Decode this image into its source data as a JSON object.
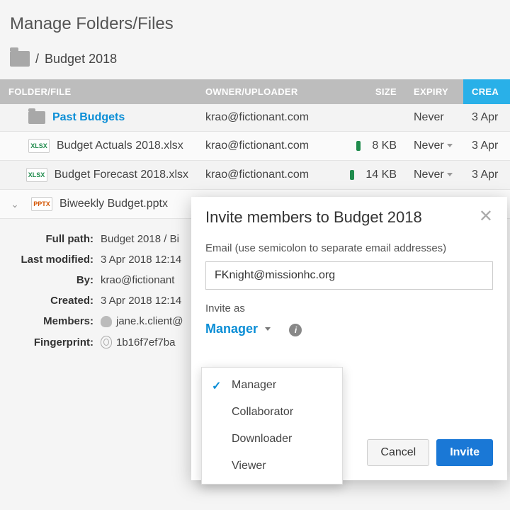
{
  "page": {
    "title": "Manage Folders/Files"
  },
  "breadcrumb": {
    "sep": "/",
    "folder": "Budget 2018"
  },
  "table": {
    "headers": {
      "file": "FOLDER/FILE",
      "owner": "OWNER/UPLOADER",
      "size": "SIZE",
      "expiry": "EXPIRY",
      "created": "CREA"
    },
    "rows": [
      {
        "icon": "folder",
        "name": "Past Budgets",
        "link": true,
        "owner": "krao@fictionant.com",
        "size": "",
        "expiry": "Never",
        "expiry_caret": false,
        "created": "3 Apr"
      },
      {
        "icon": "xlsx",
        "name": "Budget Actuals 2018.xlsx",
        "owner": "krao@fictionant.com",
        "size": "8 KB",
        "pill": true,
        "expiry": "Never",
        "expiry_caret": true,
        "created": "3 Apr"
      },
      {
        "icon": "xlsx",
        "name": "Budget Forecast 2018.xlsx",
        "owner": "krao@fictionant.com",
        "size": "14 KB",
        "pill": true,
        "expiry": "Never",
        "expiry_caret": true,
        "created": "3 Apr"
      },
      {
        "icon": "pptx",
        "name": "Biweekly Budget.pptx",
        "expanded": true,
        "owner": "",
        "size": "",
        "expiry": "",
        "created": ""
      }
    ],
    "icon_labels": {
      "xlsx": "XLSX",
      "pptx": "PPTX"
    }
  },
  "details": {
    "full_path": {
      "label": "Full path:",
      "value": "Budget 2018 / Bi"
    },
    "last_modified": {
      "label": "Last modified:",
      "value": "3 Apr 2018 12:14"
    },
    "by": {
      "label": "By:",
      "value": "krao@fictionant"
    },
    "created": {
      "label": "Created:",
      "value": "3 Apr 2018 12:14"
    },
    "members": {
      "label": "Members:",
      "value": "jane.k.client@"
    },
    "fingerprint": {
      "label": "Fingerprint:",
      "value": "1b16f7ef7ba"
    }
  },
  "modal": {
    "title": "Invite members to Budget 2018",
    "email_label": "Email (use semicolon to separate email addresses)",
    "email_value": "FKnight@missionhc.org",
    "invite_as_label": "Invite as",
    "selected_role": "Manager",
    "roles": [
      "Manager",
      "Collaborator",
      "Downloader",
      "Viewer"
    ],
    "cancel": "Cancel",
    "invite": "Invite"
  }
}
